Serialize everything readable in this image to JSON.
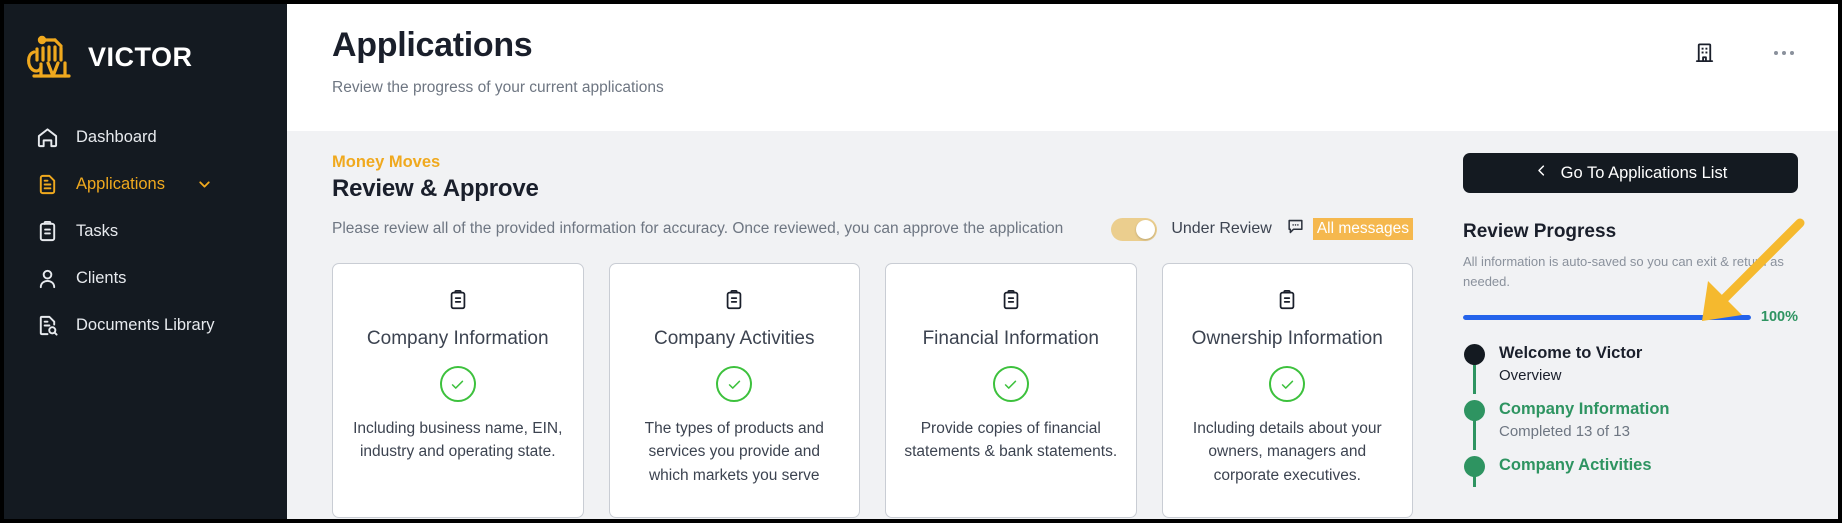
{
  "brand": {
    "name": "VICTOR",
    "logo_icon": "victor-lion-logo",
    "accent_color": "#F0A91E"
  },
  "sidebar": {
    "items": [
      {
        "label": "Dashboard",
        "icon": "home-icon",
        "active": false,
        "has_chevron": false
      },
      {
        "label": "Applications",
        "icon": "document-icon",
        "active": true,
        "has_chevron": true
      },
      {
        "label": "Tasks",
        "icon": "clipboard-icon",
        "active": false,
        "has_chevron": false
      },
      {
        "label": "Clients",
        "icon": "user-icon",
        "active": false,
        "has_chevron": false
      },
      {
        "label": "Documents Library",
        "icon": "document-search-icon",
        "active": false,
        "has_chevron": false
      }
    ]
  },
  "header": {
    "title": "Applications",
    "subtitle": "Review the progress of your current applications",
    "building_icon": "building-icon",
    "overflow_icon": "ellipsis-icon"
  },
  "section": {
    "eyebrow": "Money Moves",
    "title": "Review & Approve",
    "note": "Please review all of the provided information for accuracy. Once reviewed, you can approve the application",
    "toggle_label": "Under Review",
    "toggle_on": true,
    "toggle_color": "#EBCE8E",
    "messages_icon": "chat-bubble-icon",
    "messages_label": "All messages",
    "messages_highlight_color": "#F5B84E"
  },
  "cards": [
    {
      "icon": "clipboard-icon",
      "title": "Company Information",
      "status_icon": "check-circle-icon",
      "status_color": "#3DC13D",
      "description": "Including business name, EIN, industry and operating state."
    },
    {
      "icon": "clipboard-icon",
      "title": "Company Activities",
      "status_icon": "check-circle-icon",
      "status_color": "#3DC13D",
      "description": "The types of products and services you provide and which markets you serve"
    },
    {
      "icon": "clipboard-icon",
      "title": "Financial Information",
      "status_icon": "check-circle-icon",
      "status_color": "#3DC13D",
      "description": "Provide copies of financial statements & bank statements."
    },
    {
      "icon": "clipboard-icon",
      "title": "Ownership Information",
      "status_icon": "check-circle-icon",
      "status_color": "#3DC13D",
      "description": "Including details about your owners, managers and corporate executives."
    }
  ],
  "panel": {
    "back_button_label": "Go To Applications List",
    "back_icon": "chevron-left-icon",
    "progress_title": "Review Progress",
    "progress_note": "All information is auto-saved so you can exit & return as needed.",
    "progress_percent_label": "100%",
    "progress_percent_value": 100,
    "progress_bar_color": "#2463EB",
    "timeline": [
      {
        "label": "Welcome to Victor",
        "sub": "Overview",
        "dot_color": "#141A21",
        "label_color": "#1A1F2B"
      },
      {
        "label": "Company Information",
        "sub": "Completed 13 of 13",
        "dot_color": "#2E9461",
        "label_color": "#2E9461"
      },
      {
        "label": "Company Activities",
        "sub": "",
        "dot_color": "#2E9461",
        "label_color": "#2E9461"
      }
    ]
  },
  "annotation": {
    "arrow_icon": "annotation-arrow-icon",
    "arrow_color": "#F5B92E"
  }
}
